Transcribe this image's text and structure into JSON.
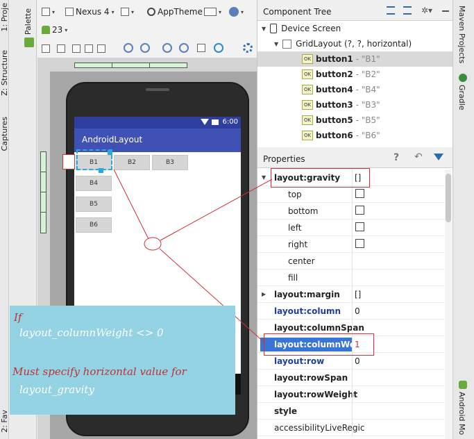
{
  "left_strip": {
    "project_tab": "1: Proje",
    "structure_tab": "Z: Structure",
    "captures_tab": "Captures",
    "favorites_tab": "2: Fav"
  },
  "palette_tab": "Palette",
  "toolbar": {
    "device": "Nexus 4",
    "api": "23",
    "theme": "AppTheme"
  },
  "phone": {
    "time": "6:00",
    "app_title": "AndroidLayout",
    "buttons": [
      "B1",
      "B2",
      "B3",
      "B4",
      "B5",
      "B6"
    ]
  },
  "component_tree": {
    "title": "Component Tree",
    "root": "Device Screen",
    "layout": "GridLayout (?, ?, horizontal)",
    "items": [
      {
        "id": "button1",
        "text": "- \"B1\""
      },
      {
        "id": "button2",
        "text": "- \"B2\""
      },
      {
        "id": "button4",
        "text": "- \"B4\""
      },
      {
        "id": "button3",
        "text": "- \"B3\""
      },
      {
        "id": "button5",
        "text": "- \"B5\""
      },
      {
        "id": "button6",
        "text": "- \"B6\""
      }
    ]
  },
  "properties": {
    "title": "Properties",
    "rows": {
      "gravity": {
        "name": "layout:gravity",
        "value": "[]"
      },
      "top": "top",
      "bottom": "bottom",
      "left": "left",
      "right": "right",
      "center": "center",
      "fill": "fill",
      "margin": {
        "name": "layout:margin",
        "value": "[]"
      },
      "column": {
        "name": "layout:column",
        "value": "0"
      },
      "columnSpan": {
        "name": "layout:columnSpan",
        "value": ""
      },
      "columnWeight": {
        "name": "layout:columnWeigh",
        "value": "1"
      },
      "row": {
        "name": "layout:row",
        "value": "0"
      },
      "rowSpan": {
        "name": "layout:rowSpan",
        "value": ""
      },
      "rowWeight": {
        "name": "layout:rowWeight",
        "value": ""
      },
      "style": {
        "name": "style",
        "value": ""
      },
      "access": {
        "name": "accessibilityLiveRegic",
        "value": ""
      }
    }
  },
  "right_strip": {
    "maven": "Maven Projects",
    "gradle": "Gradle",
    "android_monitor": "Android Mo"
  },
  "note": {
    "line1": "If",
    "line2": "layout_columnWeight <> 0",
    "line3": "Must specify horizontal value for",
    "line4": "layout_gravity"
  },
  "colors": {
    "accent": "#3f51b5",
    "statusbar": "#303f9f",
    "annotation": "#d0303a",
    "note_bg": "#94d3e3",
    "selected_prop": "#3875d7"
  }
}
